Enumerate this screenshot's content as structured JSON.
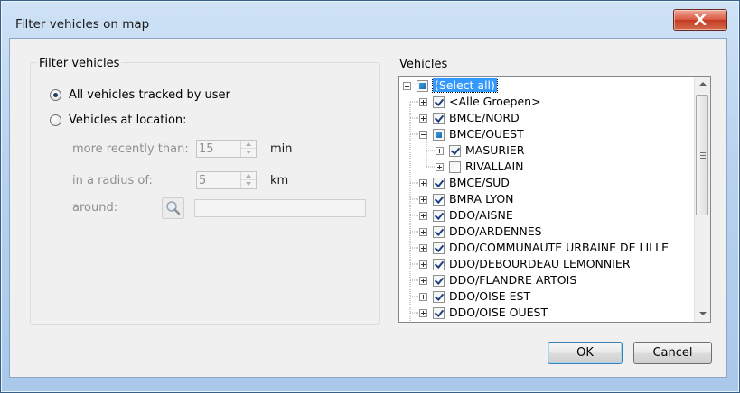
{
  "window": {
    "title": "Filter vehicles on map"
  },
  "filter": {
    "group_title": "Filter vehicles",
    "option_all": "All vehicles tracked by user",
    "option_location": "Vehicles at location:",
    "selected_option": "All vehicles tracked by user",
    "recent_label": "more recently than:",
    "recent_value": "15",
    "recent_unit": "min",
    "radius_label": "in a radius of:",
    "radius_value": "5",
    "radius_unit": "km",
    "around_label": "around:",
    "around_value": ""
  },
  "vehicles": {
    "label": "Vehicles",
    "tree": [
      {
        "label": "(Select all)",
        "level": 0,
        "expander": "minus",
        "state": "partial",
        "selected": true
      },
      {
        "label": "<Alle Groepen>",
        "level": 1,
        "expander": "plus",
        "state": "checked"
      },
      {
        "label": "BMCE/NORD",
        "level": 1,
        "expander": "plus",
        "state": "checked"
      },
      {
        "label": "BMCE/OUEST",
        "level": 1,
        "expander": "minus",
        "state": "partial"
      },
      {
        "label": "MASURIER",
        "level": 2,
        "expander": "plus",
        "state": "checked"
      },
      {
        "label": "RIVALLAIN",
        "level": 2,
        "expander": "plus",
        "state": "unchecked"
      },
      {
        "label": "BMCE/SUD",
        "level": 1,
        "expander": "plus",
        "state": "checked"
      },
      {
        "label": "BMRA LYON",
        "level": 1,
        "expander": "plus",
        "state": "checked"
      },
      {
        "label": "DDO/AISNE",
        "level": 1,
        "expander": "plus",
        "state": "checked"
      },
      {
        "label": "DDO/ARDENNES",
        "level": 1,
        "expander": "plus",
        "state": "checked"
      },
      {
        "label": "DDO/COMMUNAUTE URBAINE DE LILLE",
        "level": 1,
        "expander": "plus",
        "state": "checked"
      },
      {
        "label": "DDO/DEBOURDEAU LEMONNIER",
        "level": 1,
        "expander": "plus",
        "state": "checked"
      },
      {
        "label": "DDO/FLANDRE ARTOIS",
        "level": 1,
        "expander": "plus",
        "state": "checked"
      },
      {
        "label": "DDO/OISE EST",
        "level": 1,
        "expander": "plus",
        "state": "checked"
      },
      {
        "label": "DDO/OISE OUEST",
        "level": 1,
        "expander": "plus",
        "state": "checked"
      }
    ]
  },
  "buttons": {
    "ok": "OK",
    "cancel": "Cancel"
  },
  "icons": {
    "close": "close-icon",
    "search": "magnifier-icon"
  },
  "colors": {
    "selection": "#3399ff",
    "check": "#1c3e7e",
    "close_button": "#c94a32"
  }
}
